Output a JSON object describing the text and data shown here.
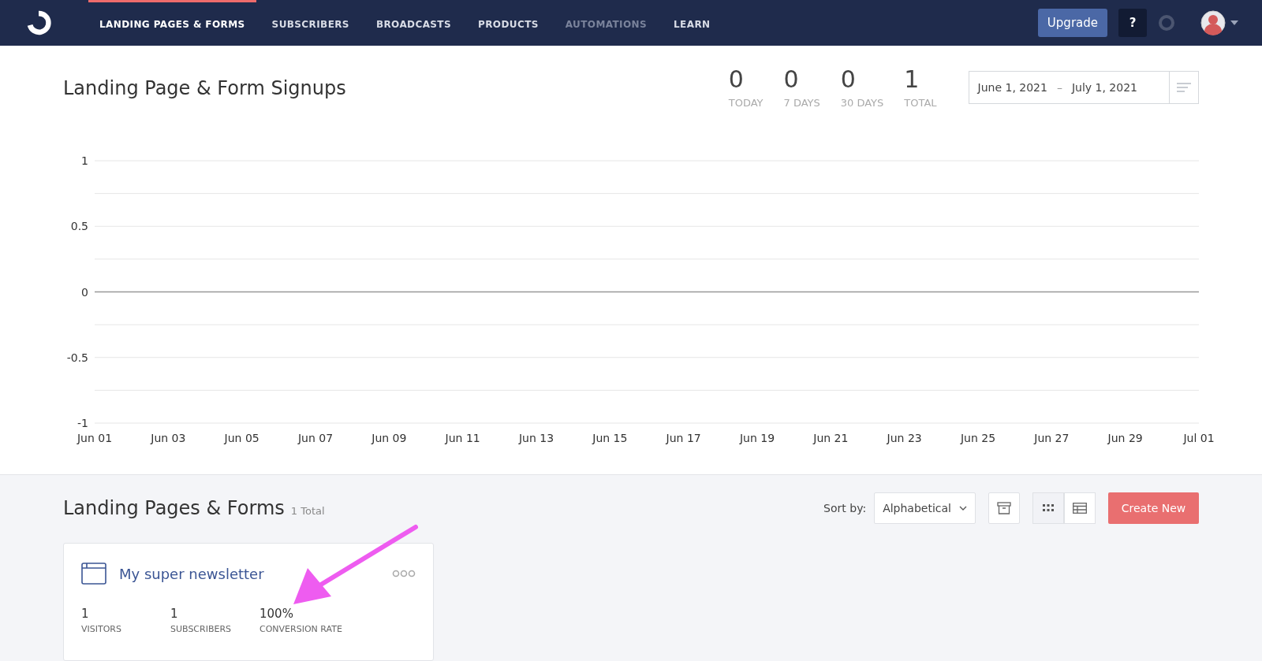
{
  "nav": {
    "items": [
      {
        "label": "LANDING PAGES & FORMS",
        "selected": true,
        "disabled": false
      },
      {
        "label": "SUBSCRIBERS",
        "selected": false,
        "disabled": false
      },
      {
        "label": "BROADCASTS",
        "selected": false,
        "disabled": false
      },
      {
        "label": "PRODUCTS",
        "selected": false,
        "disabled": false
      },
      {
        "label": "AUTOMATIONS",
        "selected": false,
        "disabled": true
      },
      {
        "label": "LEARN",
        "selected": false,
        "disabled": false
      }
    ],
    "upgrade": "Upgrade",
    "help": "?"
  },
  "signups": {
    "title": "Landing Page & Form Signups",
    "stats": [
      {
        "value": "0",
        "label": "TODAY"
      },
      {
        "value": "0",
        "label": "7 DAYS"
      },
      {
        "value": "0",
        "label": "30 DAYS"
      },
      {
        "value": "1",
        "label": "TOTAL"
      }
    ],
    "date_start": "June 1, 2021",
    "date_sep": "–",
    "date_end": "July 1, 2021",
    "chart_data": {
      "type": "line",
      "categories": [
        "Jun 01",
        "Jun 03",
        "Jun 05",
        "Jun 07",
        "Jun 09",
        "Jun 11",
        "Jun 13",
        "Jun 15",
        "Jun 17",
        "Jun 19",
        "Jun 21",
        "Jun 23",
        "Jun 25",
        "Jun 27",
        "Jun 29",
        "Jul 01"
      ],
      "series": [
        {
          "color": "#999999",
          "values": [
            0,
            0,
            0,
            0,
            0,
            0,
            0,
            0,
            0,
            0,
            0,
            0,
            0,
            0,
            0,
            0
          ]
        }
      ],
      "ylim": [
        -1,
        1
      ],
      "yticks": [
        {
          "value": -1,
          "label": "-1"
        },
        {
          "value": -0.5,
          "label": "-0.5"
        },
        {
          "value": 0,
          "label": "0"
        },
        {
          "value": 0.5,
          "label": "0.5"
        },
        {
          "value": 1,
          "label": "1"
        }
      ]
    }
  },
  "list": {
    "title": "Landing Pages & Forms",
    "count": "1 Total",
    "sort_label": "Sort by:",
    "sort_value": "Alphabetical",
    "create": "Create New",
    "views": [
      {
        "kind": "grid",
        "selected": true
      },
      {
        "kind": "table",
        "selected": false
      }
    ],
    "cards": [
      {
        "title": "My super newsletter",
        "stats": [
          {
            "value": "1",
            "label": "VISITORS"
          },
          {
            "value": "1",
            "label": "SUBSCRIBERS"
          },
          {
            "value": "100%",
            "label": "CONVERSION RATE"
          }
        ]
      }
    ]
  }
}
